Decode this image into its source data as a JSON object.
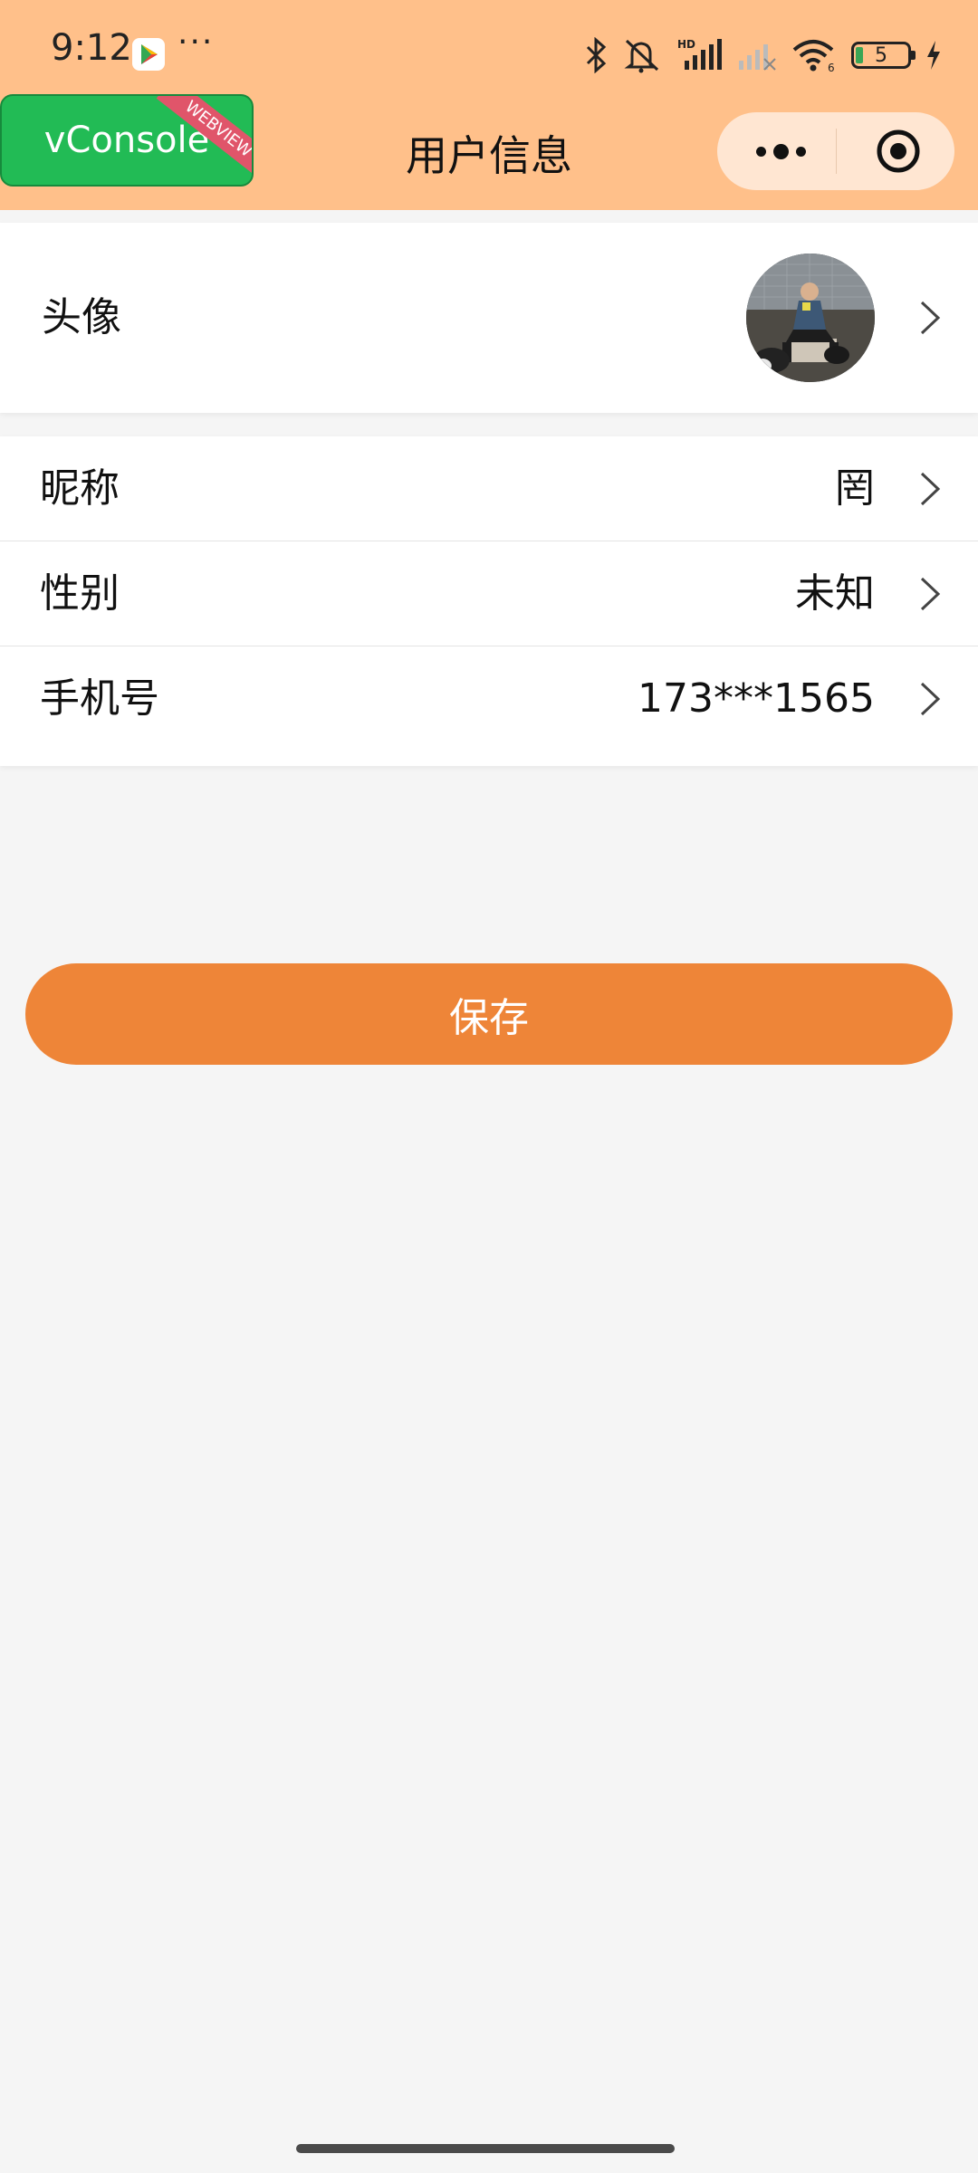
{
  "status_bar": {
    "time": "9:12",
    "more": "···",
    "battery_level": "5",
    "icons": [
      "play-store-icon",
      "bluetooth-icon",
      "mute-icon",
      "hd-signal-icon",
      "signal-icon",
      "wifi-icon",
      "battery-icon",
      "charging-icon"
    ]
  },
  "vconsole": {
    "label": "vConsole",
    "ribbon": "WEBVIEW"
  },
  "nav": {
    "title": "用户信息"
  },
  "profile": {
    "avatar_label": "头像",
    "rows": [
      {
        "label": "昵称",
        "value": "罔"
      },
      {
        "label": "性别",
        "value": "未知"
      },
      {
        "label": "手机号",
        "value": "173***1565"
      }
    ]
  },
  "actions": {
    "save_label": "保存"
  },
  "colors": {
    "header_bg": "#ffc08a",
    "capsule_bg": "#ffe6d2",
    "vconsole_bg": "#22bb55",
    "ribbon_bg": "#e0556a",
    "primary": "#ee8538",
    "page_bg": "#f5f5f5"
  }
}
